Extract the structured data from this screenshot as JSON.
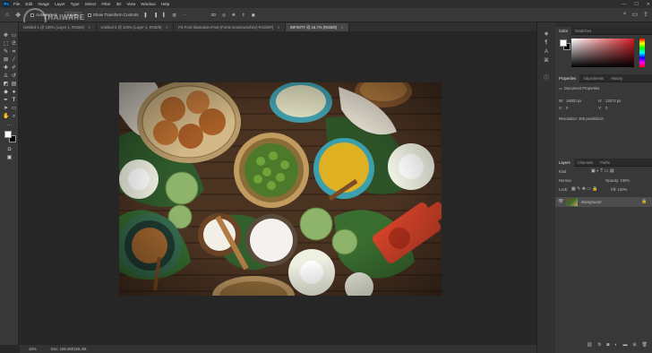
{
  "menu": {
    "logo": "Ps",
    "items": [
      "File",
      "Edit",
      "Image",
      "Layer",
      "Type",
      "Select",
      "Filter",
      "3D",
      "View",
      "Window",
      "Help"
    ]
  },
  "window_controls": {
    "minimize": "—",
    "maximize": "☐",
    "close": "✕"
  },
  "options_bar": {
    "show_transform_controls": "Show Transform Controls",
    "auto_select": "Auto-Select:",
    "layer_select": "Layer"
  },
  "watermark": {
    "line1": "THAIWARE",
    "line2": "REVIEW"
  },
  "tabs": [
    {
      "label": "Untitled-1 @ 100% (Layer 1, RGB/8)"
    },
    {
      "label": "Untitled-2 @ 100% (Layer 1, RGB/8)"
    },
    {
      "label": "PS Font-Illustration-Font-(Fonts Grantownshire)-RGB/8#)"
    },
    {
      "label": "INFINITY @ 16.7% (RGB/8)",
      "active": true
    }
  ],
  "status": {
    "zoom": "16%",
    "doc": "Doc: 165.4M/165.4M"
  },
  "color_panel": {
    "tabs": [
      "Color",
      "Swatches"
    ]
  },
  "properties_panel": {
    "tabs": [
      "Properties",
      "Adjustments",
      "History"
    ],
    "title": "Document Properties",
    "w_label": "W:",
    "w_value": "18000 px",
    "h_label": "H:",
    "h_value": "12072 px",
    "x_label": "X:",
    "x_value": "0",
    "y_label": "Y:",
    "y_value": "0",
    "resolution": "Resolution: 300 pixels/inch"
  },
  "layers_panel": {
    "tabs": [
      "Layers",
      "Channels",
      "Paths"
    ],
    "kind": "Kind",
    "mode": "Normal",
    "opacity": "Opacity: 100%",
    "lock": "Lock:",
    "fill": "Fill: 100%",
    "layer_name": "Background"
  },
  "colors": {
    "accent": "#31a8ff",
    "bg": "#282828",
    "panel": "#383838"
  }
}
